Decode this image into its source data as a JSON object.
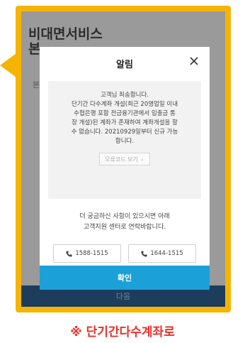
{
  "background": {
    "title": "비대면서비스",
    "title_second_line": "본",
    "side_char": "본",
    "bottom_bar_label": "다음"
  },
  "modal": {
    "title": "알림",
    "close_icon": "close-icon",
    "message_lines": [
      "고객님 죄송합니다.",
      "단기간 다수계좌 개설(최근 20영업일 이내",
      "수협은행 포함 전금융기관에서 입출금 통",
      "장 개설)된 계좌가 존재하여 계좌개설을 할",
      "수 없습니다. 20210929일부터 신규 가능",
      "합니다."
    ],
    "error_code_label": "오류코드 보기",
    "inquiry_lines": [
      "더 궁금하신 사항이 있으시면 아래",
      "고객지원 센터로 연락바랍니다."
    ],
    "phones": [
      "1588-1515",
      "1644-1515"
    ],
    "phone_icon": "phone-icon",
    "confirm_label": "확인"
  },
  "caption": "※ 단기간다수계좌로",
  "colors": {
    "frame": "#f5b400",
    "confirm": "#1ba0d8",
    "caption": "#e8302b",
    "bottom_bar": "#1d3d5c"
  }
}
